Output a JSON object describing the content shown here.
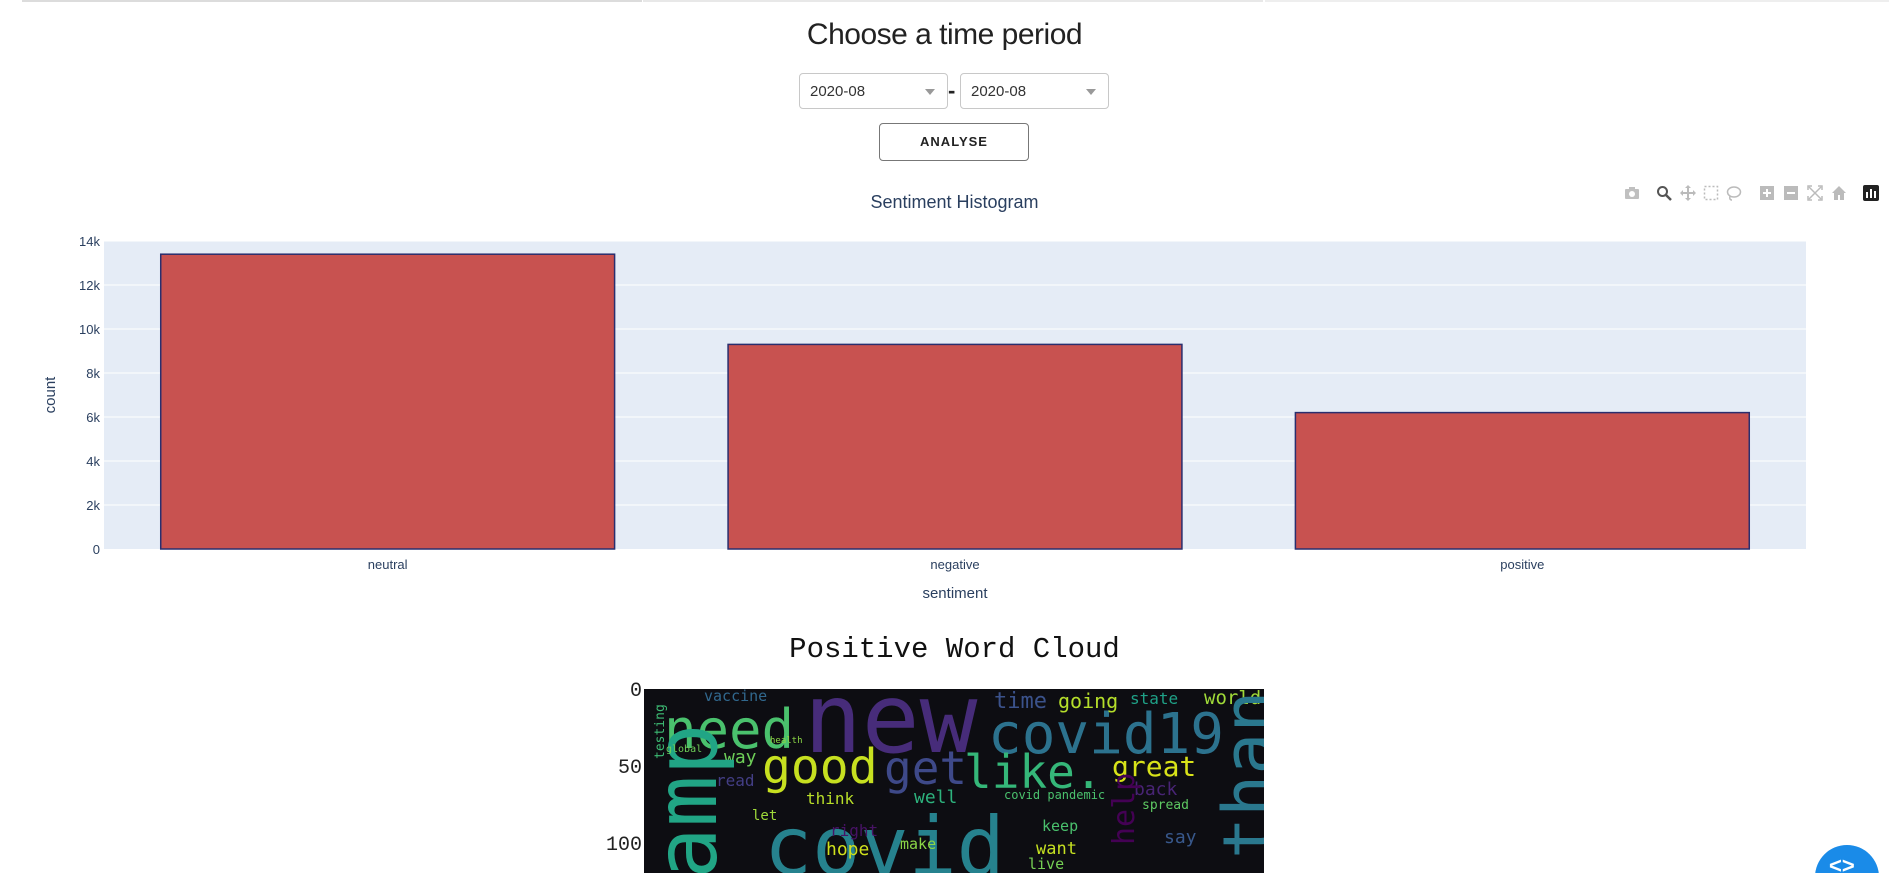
{
  "page": {
    "heading": "Choose a time period"
  },
  "period": {
    "start_value": "2020-08",
    "end_value": "2020-08",
    "separator": "-",
    "analyse_label": "ANALYSE"
  },
  "modebar": {
    "icons": [
      "camera-icon",
      "zoom-icon",
      "pan-icon",
      "box-select-icon",
      "lasso-select-icon",
      "zoom-in-icon",
      "zoom-out-icon",
      "autoscale-icon",
      "reset-axes-icon",
      "plotly-logo-icon"
    ]
  },
  "chart_data": {
    "type": "bar",
    "title": "Sentiment Histogram",
    "xlabel": "sentiment",
    "ylabel": "count",
    "categories": [
      "neutral",
      "negative",
      "positive"
    ],
    "values": [
      13400,
      9300,
      6200
    ],
    "ylim": [
      0,
      14000
    ],
    "yticks": [
      "0",
      "2k",
      "4k",
      "6k",
      "8k",
      "10k",
      "12k",
      "14k"
    ],
    "bar_color": "#c85250",
    "bar_outline": "#2a2e6e",
    "plot_bg": "#e5ecf6",
    "grid": true
  },
  "wordcloud": {
    "title": "Positive Word Cloud",
    "yticks": [
      "0",
      "50",
      "100"
    ]
  },
  "colors": {
    "fab": "#1a8be8"
  }
}
